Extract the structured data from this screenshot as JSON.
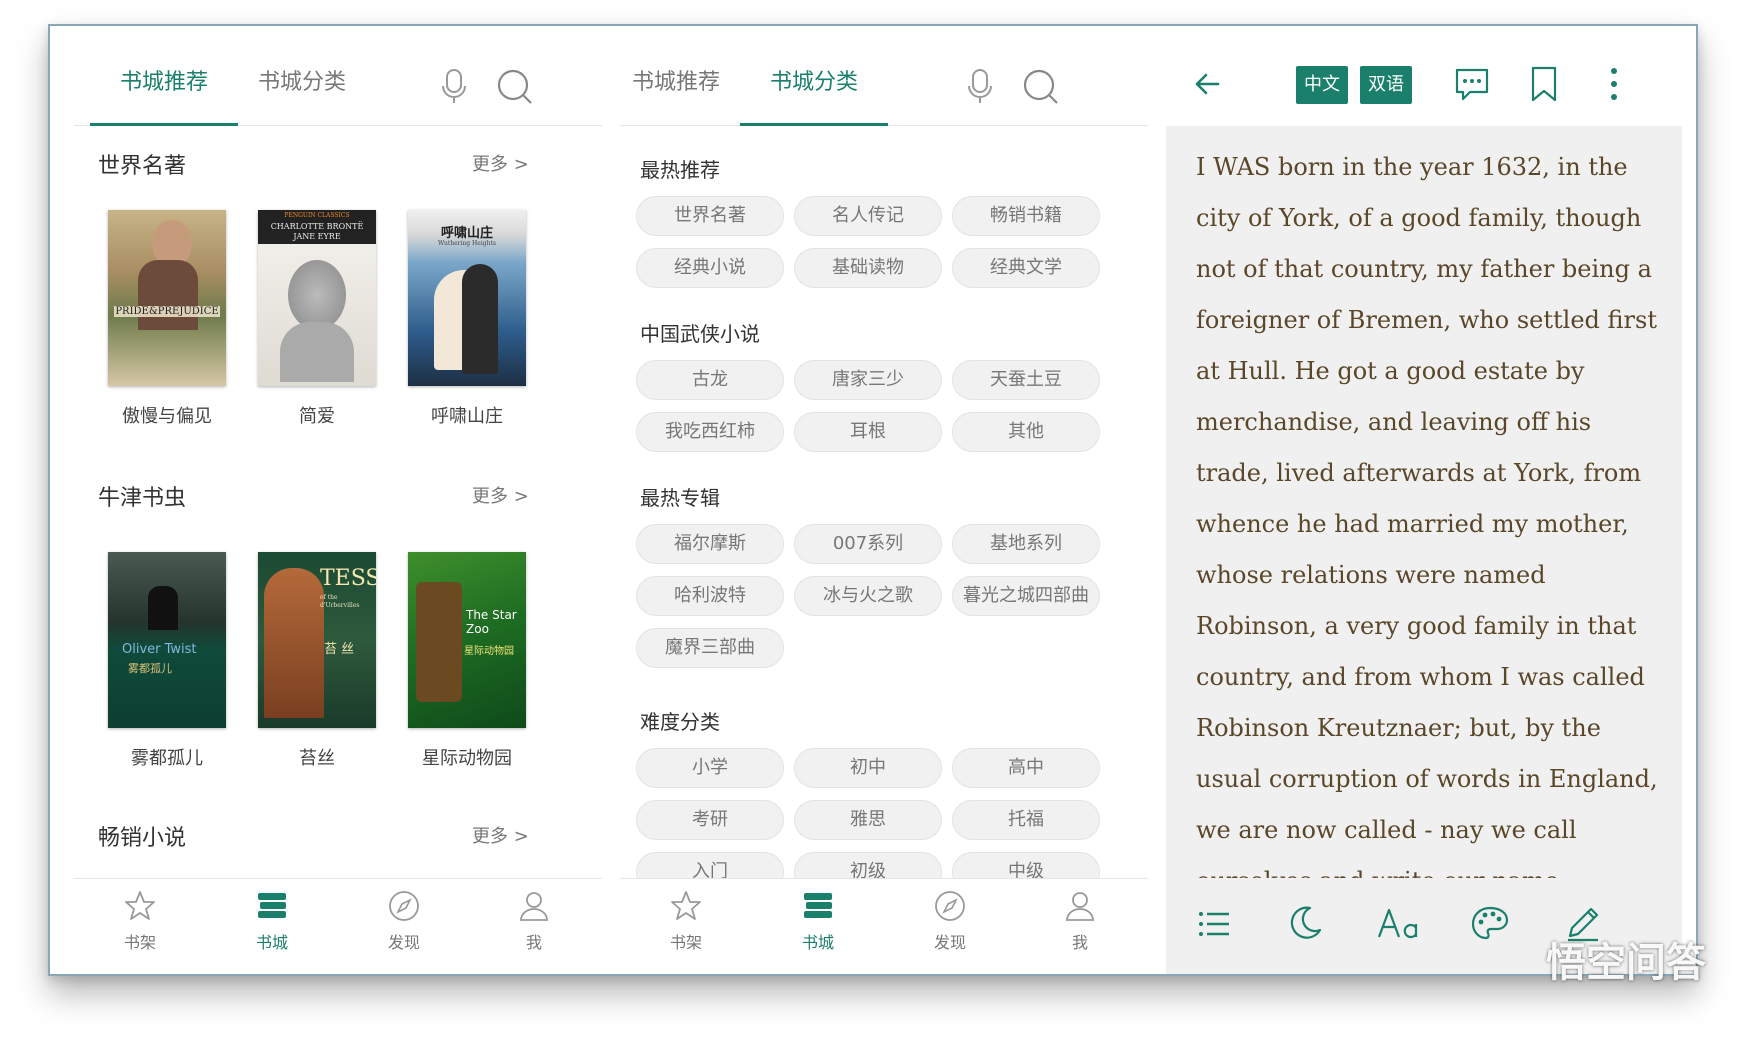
{
  "colors": {
    "accent": "#1a7f6b",
    "text": "#333333",
    "reader_bg": "#f0f0f0",
    "reader_text": "#5a4628"
  },
  "store_tabs": {
    "recommend": "书城推荐",
    "category": "书城分类"
  },
  "sections": [
    {
      "title": "世界名著",
      "more": "更多 >",
      "books": [
        {
          "title": "傲慢与偏见",
          "cover_text": "PRIDE&PREJUDICE"
        },
        {
          "title": "简爱",
          "cover_text": "CHARLOTTE BRONTË JANE EYRE",
          "cover_sub": "PENGUIN CLASSICS"
        },
        {
          "title": "呼啸山庄",
          "cover_text": "呼啸山庄",
          "cover_sub": "Wuthering Heights"
        }
      ]
    },
    {
      "title": "牛津书虫",
      "more": "更多 >",
      "books": [
        {
          "title": "雾都孤儿",
          "cover_text": "Oliver Twist",
          "cover_sub": "雾都孤儿"
        },
        {
          "title": "苔丝",
          "cover_text": "TESS",
          "cover_sub": "of the d'Urbervilles",
          "cover_cn": "苔 丝"
        },
        {
          "title": "星际动物园",
          "cover_text": "The Star Zoo",
          "cover_sub": "星际动物园"
        }
      ]
    },
    {
      "title": "畅销小说",
      "more": "更多 >"
    }
  ],
  "nav": [
    {
      "label": "书架",
      "icon": "star-icon"
    },
    {
      "label": "书城",
      "icon": "books-icon"
    },
    {
      "label": "发现",
      "icon": "compass-icon"
    },
    {
      "label": "我",
      "icon": "person-icon"
    }
  ],
  "categories": [
    {
      "title": "最热推荐",
      "chips": [
        "世界名著",
        "名人传记",
        "畅销书籍",
        "经典小说",
        "基础读物",
        "经典文学"
      ]
    },
    {
      "title": "中国武侠小说",
      "chips": [
        "古龙",
        "唐家三少",
        "天蚕土豆",
        "我吃西红柿",
        "耳根",
        "其他"
      ]
    },
    {
      "title": "最热专辑",
      "chips": [
        "福尔摩斯",
        "007系列",
        "基地系列",
        "哈利波特",
        "冰与火之歌",
        "暮光之城四部曲",
        "魔界三部曲"
      ]
    },
    {
      "title": "难度分类",
      "chips": [
        "小学",
        "初中",
        "高中",
        "考研",
        "雅思",
        "托福",
        "入门",
        "初级",
        "中级"
      ]
    }
  ],
  "reader": {
    "lang_cn": "中文",
    "lang_bi": "双语",
    "text": "I WAS born in the year 1632, in the city of York, of a good family, though not of that country, my father being a foreigner of Bremen, who settled first at Hull. He got a good estate by merchandise, and leaving off his trade, lived afterwards at York, from whence he had married my mother, whose relations were named Robinson, a very good family in that country, and from whom I was called Robinson Kreutznaer; but, by the usual corruption of words in England, we are now called - nay we call ourselves and write our name"
  },
  "watermark": "悟空问答"
}
